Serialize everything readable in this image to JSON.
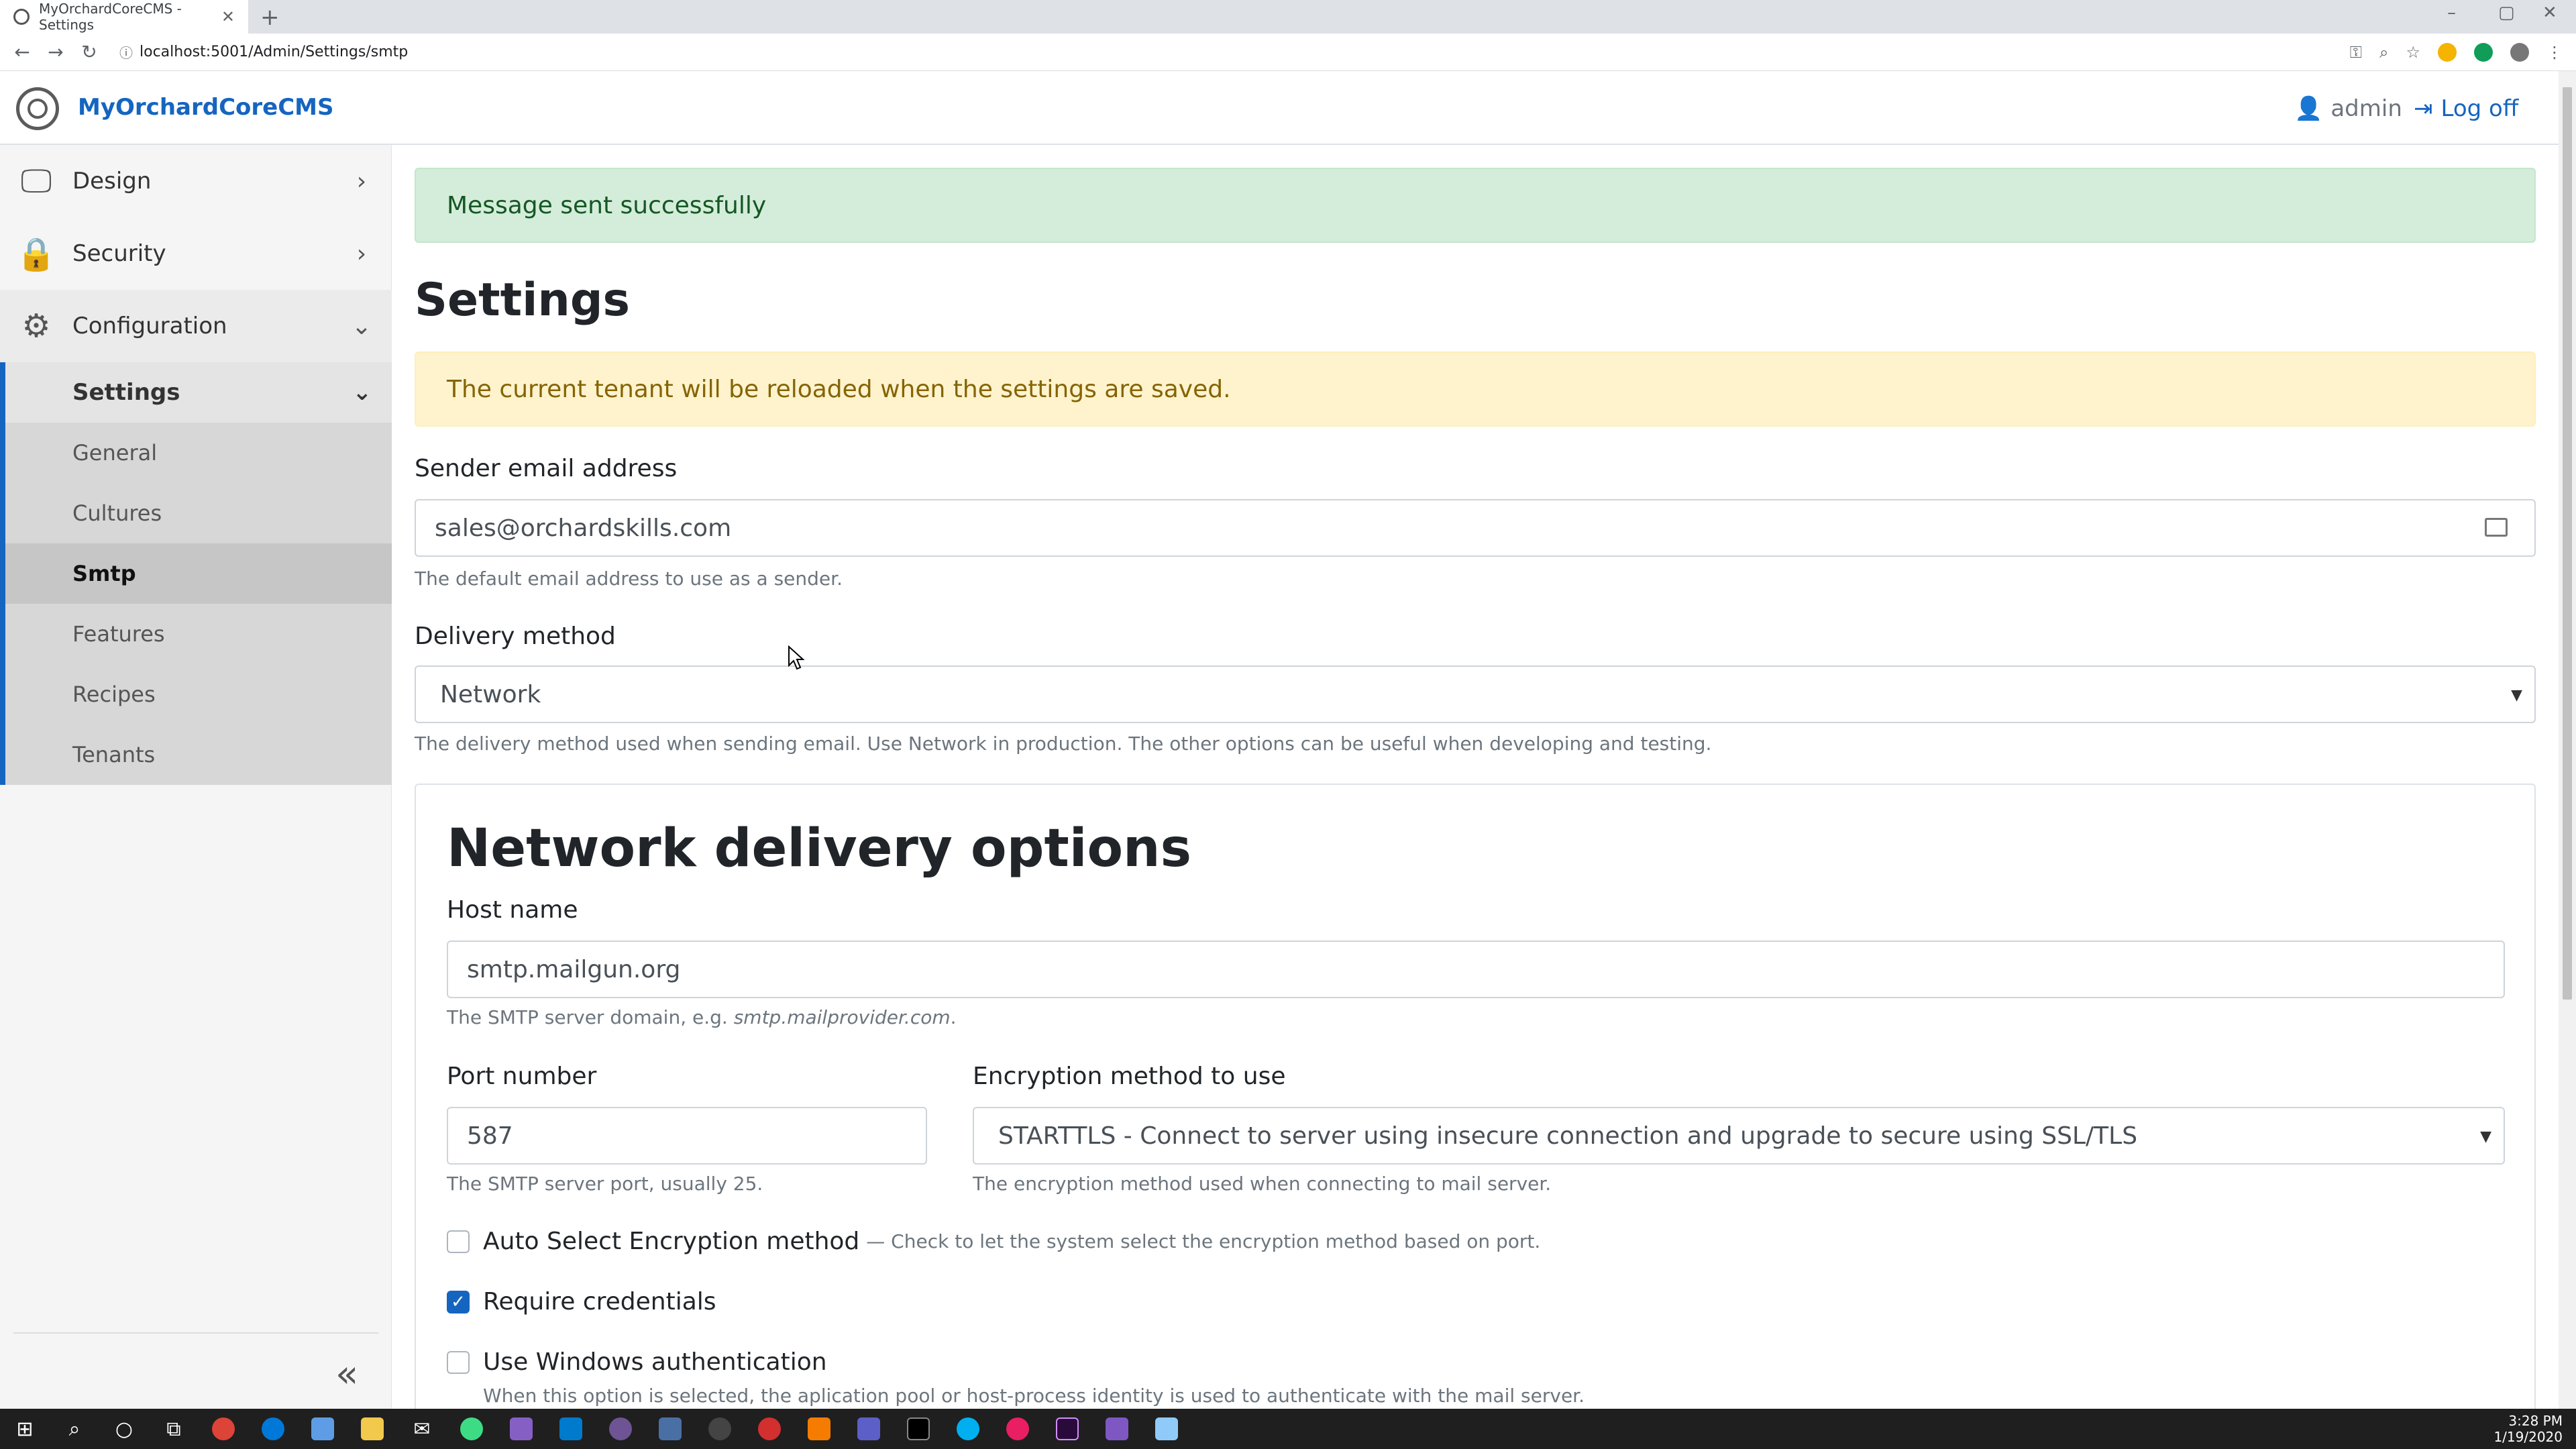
{
  "browser": {
    "tab_title": "MyOrchardCoreCMS - Settings",
    "tab_close": "✕",
    "new_tab": "+",
    "url": "localhost:5001/Admin/Settings/smtp",
    "controls": {
      "minimize": "–",
      "maximize": "▢",
      "close": "✕"
    }
  },
  "header": {
    "brand": "MyOrchardCoreCMS",
    "user": "admin",
    "logoff": "Log off"
  },
  "sidebar": {
    "items": [
      {
        "label": "Design",
        "icon": "monitor-icon"
      },
      {
        "label": "Security",
        "icon": "lock-icon"
      },
      {
        "label": "Configuration",
        "icon": "gear-icon"
      }
    ],
    "submenu_title": "Settings",
    "subitems": [
      "General",
      "Cultures",
      "Smtp",
      "Features",
      "Recipes",
      "Tenants"
    ],
    "selected": "Smtp",
    "collapse": "«"
  },
  "main": {
    "success_message": "Message sent successfully",
    "title": "Settings",
    "warning_message": "The current tenant will be reloaded when the settings are saved.",
    "sender": {
      "label": "Sender email address",
      "value": "sales@orchardskills.com",
      "help": "The default email address to use as a sender."
    },
    "delivery": {
      "label": "Delivery method",
      "value": "Network",
      "help": "The delivery method used when sending email. Use Network in production. The other options can be useful when developing and testing."
    },
    "network": {
      "title": "Network delivery options",
      "host_label": "Host name",
      "host_value": "smtp.mailgun.org",
      "host_help_prefix": "The SMTP server domain, e.g. ",
      "host_help_example": "smtp.mailprovider.com",
      "host_help_suffix": ".",
      "port_label": "Port number",
      "port_value": "587",
      "port_help": "The SMTP server port, usually 25.",
      "enc_label": "Encryption method to use",
      "enc_value": "STARTTLS - Connect to server using insecure connection and upgrade to secure using SSL/TLS",
      "enc_help": "The encryption method used when connecting to mail server.",
      "auto_select_label": "Auto Select Encryption method",
      "auto_select_hint": "— Check to let the system select the encryption method based on port.",
      "auto_select_checked": false,
      "require_credentials_label": "Require credentials",
      "require_credentials_checked": true,
      "windows_auth_label": "Use Windows authentication",
      "windows_auth_checked": false,
      "windows_auth_help": "When this option is selected, the aplication pool or host-process identity is used to authenticate with the mail server."
    }
  },
  "taskbar": {
    "time": "3:28 PM",
    "date": "1/19/2020"
  },
  "colors": {
    "brand": "#1565c0",
    "success_bg": "#d4edda",
    "warning_bg": "#fff3cd"
  }
}
